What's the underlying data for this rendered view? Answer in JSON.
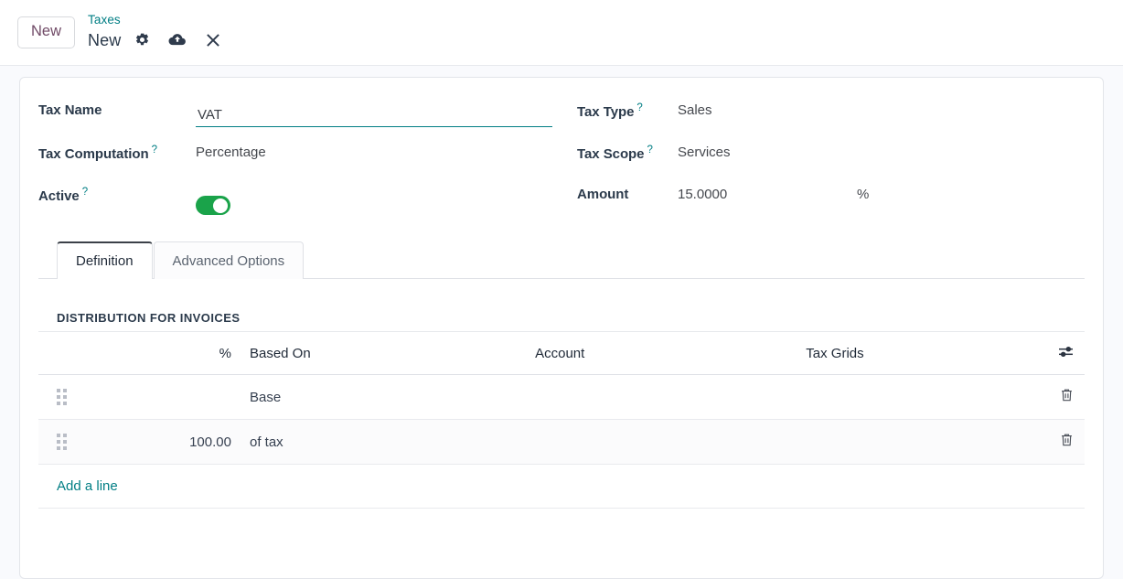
{
  "header": {
    "new_button_label": "New",
    "breadcrumb_parent": "Taxes",
    "breadcrumb_current": "New",
    "settings_icon": "gear-icon",
    "save_icon": "cloud-upload-icon",
    "discard_icon": "close-x-icon"
  },
  "form": {
    "left": [
      {
        "label": "Tax Name",
        "help": "",
        "value": "VAT",
        "type": "input"
      },
      {
        "label": "Tax Computation",
        "help": "?",
        "value": "Percentage",
        "type": "text"
      },
      {
        "label": "Active",
        "help": "?",
        "value": "on",
        "type": "toggle"
      }
    ],
    "right": [
      {
        "label": "Tax Type",
        "help": "?",
        "value": "Sales"
      },
      {
        "label": "Tax Scope",
        "help": "?",
        "value": "Services"
      },
      {
        "label": "Amount",
        "help": "",
        "value": "15.0000",
        "unit": "%"
      }
    ]
  },
  "notebook": {
    "tabs": [
      {
        "label": "Definition",
        "active": true
      },
      {
        "label": "Advanced Options",
        "active": false
      }
    ]
  },
  "distribution": {
    "section_title": "DISTRIBUTION FOR INVOICES",
    "columns": {
      "percent": "%",
      "based_on": "Based On",
      "account": "Account",
      "tax_grids": "Tax Grids"
    },
    "optional_columns_icon": "sliders-icon",
    "rows": [
      {
        "percent": "",
        "based_on": "Base",
        "account": "",
        "tax_grids": "",
        "handle_icon": "drag-handle-icon",
        "delete_icon": "trash-icon"
      },
      {
        "percent": "100.00",
        "based_on": "of tax",
        "account": "",
        "tax_grids": "",
        "handle_icon": "drag-handle-icon",
        "delete_icon": "trash-icon"
      }
    ],
    "add_line_label": "Add a line"
  },
  "colors": {
    "accent_primary": "#714b67",
    "link_teal": "#017e84",
    "toggle_on": "#1aa34a",
    "page_bg": "#f9fafd",
    "text_dark": "#2b3a4b"
  }
}
